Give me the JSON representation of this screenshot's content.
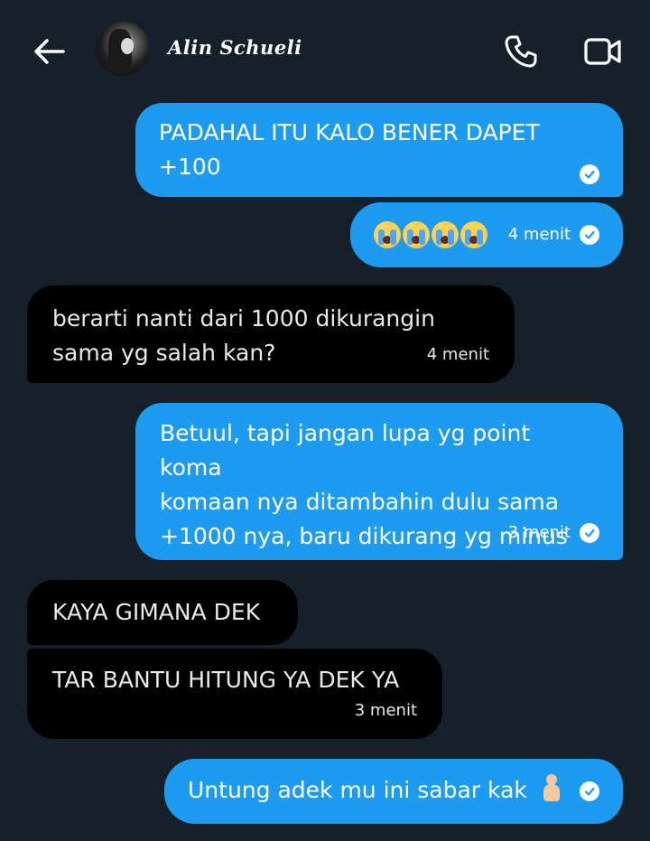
{
  "header": {
    "contact_name": "Alin Schueli",
    "back_icon": "arrow-left-icon",
    "call_icon": "phone-icon",
    "video_icon": "video-camera-icon"
  },
  "colors": {
    "background": "#15202b",
    "sent_bubble": "#1d9bf0",
    "received_bubble": "#000000"
  },
  "messages": [
    {
      "direction": "sent",
      "text": "PADAHAL ITU KALO BENER DAPET\n+100",
      "time": "",
      "read": true
    },
    {
      "direction": "sent",
      "emoji": "crying-face-emoji x4",
      "time": "4 menit",
      "read": true
    },
    {
      "direction": "received",
      "text": "berarti nanti dari 1000 dikurangin\nsama yg salah kan?",
      "time": "4 menit"
    },
    {
      "direction": "sent",
      "text": "Betuul, tapi jangan lupa yg point koma\nkomaan nya ditambahin dulu sama\n+1000 nya, baru dikurang yg minus",
      "time": "3 menit",
      "read": true
    },
    {
      "direction": "received",
      "text": "KAYA GIMANA DEK",
      "time": ""
    },
    {
      "direction": "received",
      "text": "TAR BANTU HITUNG YA DEK YA",
      "time": "3 menit"
    },
    {
      "direction": "sent",
      "text": "Untung adek mu ini sabar kak",
      "emoji": "person-kneeling-emoji",
      "time": "",
      "read": true
    }
  ]
}
